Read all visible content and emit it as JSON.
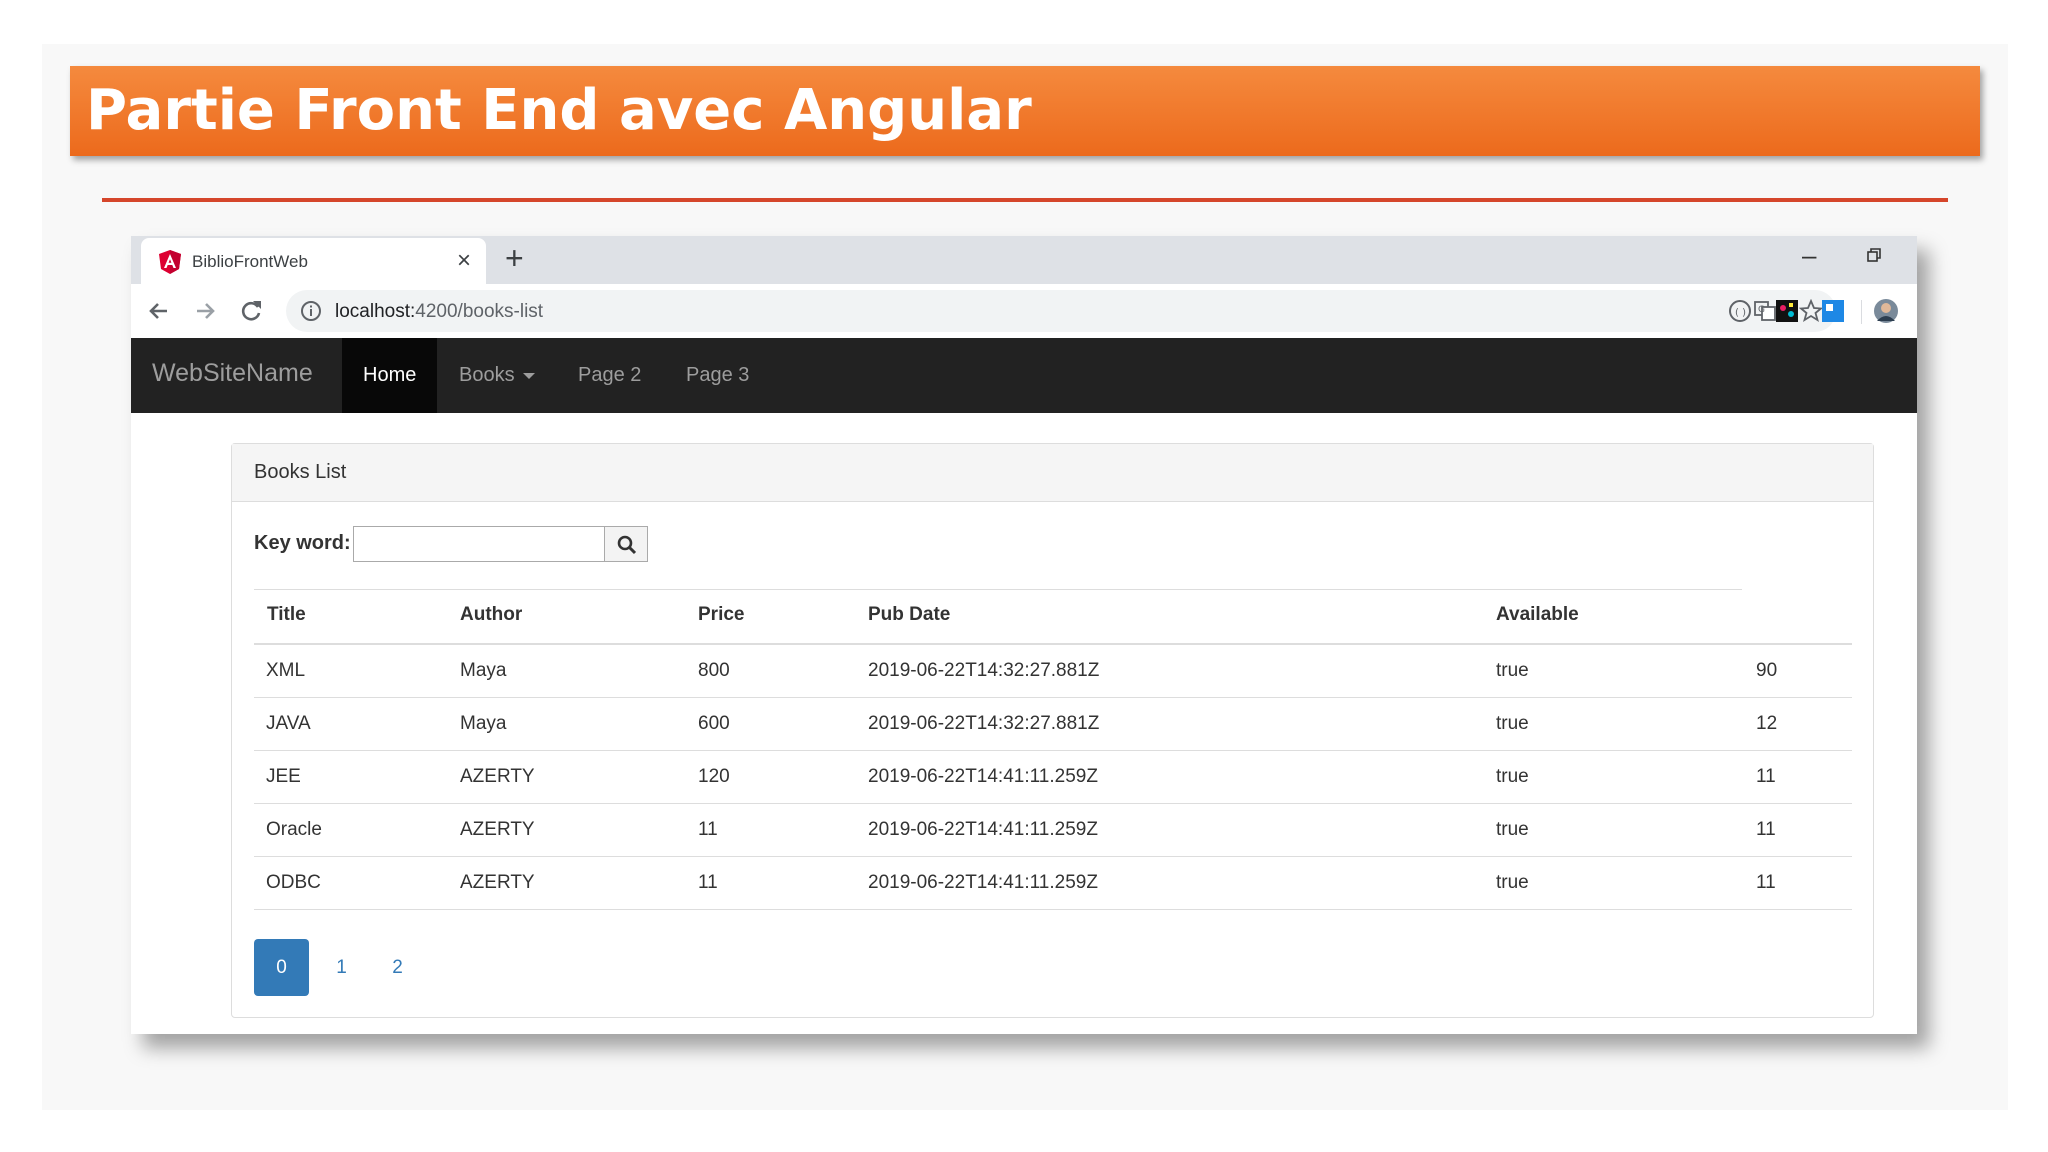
{
  "slide": {
    "title": "Partie Front End avec Angular"
  },
  "browser": {
    "tab_title": "BiblioFrontWeb",
    "url_host": "localhost:",
    "url_path": "4200/books-list",
    "icons": [
      "angular-icon",
      "close-icon",
      "plus-icon",
      "minimize-icon",
      "restore-icon",
      "back-icon",
      "forward-icon",
      "reload-icon",
      "info-icon",
      "translate-icon",
      "star-icon",
      "extension-icon",
      "avatar"
    ]
  },
  "navbar": {
    "brand": "WebSiteName",
    "items": [
      {
        "label": "Home",
        "active": true
      },
      {
        "label": "Books",
        "dropdown": true
      },
      {
        "label": "Page 2"
      },
      {
        "label": "Page 3"
      }
    ]
  },
  "panel": {
    "heading": "Books List",
    "search_label": "Key word:",
    "search_value": "",
    "search_icon": "search-icon"
  },
  "table": {
    "headers": [
      "Title",
      "Author",
      "Price",
      "Pub Date",
      "Available"
    ],
    "rows": [
      [
        "XML",
        "Maya",
        "800",
        "2019-06-22T14:32:27.881Z",
        "true",
        "90"
      ],
      [
        "JAVA",
        "Maya",
        "600",
        "2019-06-22T14:32:27.881Z",
        "true",
        "12"
      ],
      [
        "JEE",
        "AZERTY",
        "120",
        "2019-06-22T14:41:11.259Z",
        "true",
        "11"
      ],
      [
        "Oracle",
        "AZERTY",
        "11",
        "2019-06-22T14:41:11.259Z",
        "true",
        "11"
      ],
      [
        "ODBC",
        "AZERTY",
        "11",
        "2019-06-22T14:41:11.259Z",
        "true",
        "11"
      ]
    ]
  },
  "pagination": {
    "pages": [
      "0",
      "1",
      "2"
    ],
    "active": "0"
  },
  "colors": {
    "accent_orange": "#ec6a1c",
    "navbar": "#222222",
    "link_blue": "#337ab7"
  }
}
